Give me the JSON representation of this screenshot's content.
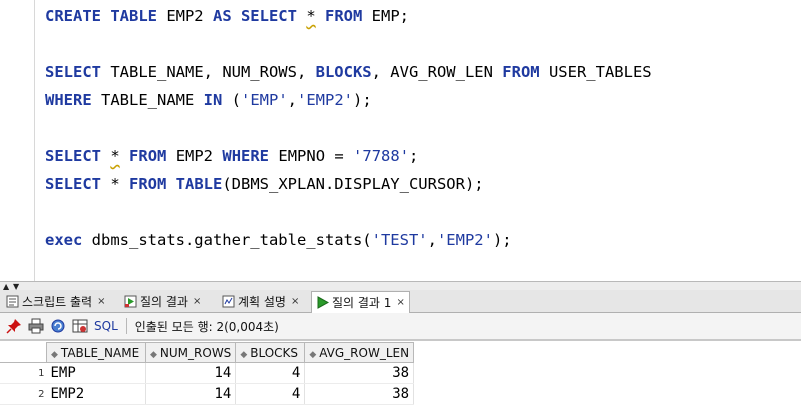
{
  "editor": {
    "lines": [
      {
        "tokens": [
          {
            "t": "CREATE TABLE",
            "k": "kw"
          },
          {
            "t": " EMP2 ",
            "k": "plain"
          },
          {
            "t": "AS SELECT",
            "k": "kw"
          },
          {
            "t": " ",
            "k": "plain"
          },
          {
            "t": "*",
            "k": "warn"
          },
          {
            "t": " ",
            "k": "plain"
          },
          {
            "t": "FROM",
            "k": "kw"
          },
          {
            "t": " EMP;",
            "k": "plain"
          }
        ]
      },
      {
        "tokens": []
      },
      {
        "tokens": [
          {
            "t": "SELECT",
            "k": "kw"
          },
          {
            "t": " TABLE_NAME, NUM_ROWS, ",
            "k": "plain"
          },
          {
            "t": "BLOCKS",
            "k": "kw"
          },
          {
            "t": ", AVG_ROW_LEN ",
            "k": "plain"
          },
          {
            "t": "FROM",
            "k": "kw"
          },
          {
            "t": " USER_TABLES",
            "k": "plain"
          }
        ]
      },
      {
        "tokens": [
          {
            "t": "WHERE",
            "k": "kw"
          },
          {
            "t": " TABLE_NAME ",
            "k": "plain"
          },
          {
            "t": "IN",
            "k": "kw"
          },
          {
            "t": " (",
            "k": "plain"
          },
          {
            "t": "'EMP'",
            "k": "str"
          },
          {
            "t": ",",
            "k": "plain"
          },
          {
            "t": "'EMP2'",
            "k": "str"
          },
          {
            "t": ");",
            "k": "plain"
          }
        ]
      },
      {
        "tokens": []
      },
      {
        "tokens": [
          {
            "t": "SELECT",
            "k": "kw"
          },
          {
            "t": " ",
            "k": "plain"
          },
          {
            "t": "*",
            "k": "warn"
          },
          {
            "t": " ",
            "k": "plain"
          },
          {
            "t": "FROM",
            "k": "kw"
          },
          {
            "t": " EMP2 ",
            "k": "plain"
          },
          {
            "t": "WHERE",
            "k": "kw"
          },
          {
            "t": " EMPNO = ",
            "k": "plain"
          },
          {
            "t": "'7788'",
            "k": "str"
          },
          {
            "t": ";",
            "k": "plain"
          }
        ]
      },
      {
        "tokens": [
          {
            "t": "SELECT",
            "k": "kw"
          },
          {
            "t": " * ",
            "k": "plain"
          },
          {
            "t": "FROM TABLE",
            "k": "kw"
          },
          {
            "t": "(DBMS_XPLAN.DISPLAY_CURSOR);",
            "k": "plain"
          }
        ]
      },
      {
        "tokens": []
      },
      {
        "tokens": [
          {
            "t": "exec",
            "k": "kw"
          },
          {
            "t": " dbms_stats.gather_table_stats(",
            "k": "plain"
          },
          {
            "t": "'TEST'",
            "k": "str"
          },
          {
            "t": ",",
            "k": "plain"
          },
          {
            "t": "'EMP2'",
            "k": "str"
          },
          {
            "t": ");",
            "k": "plain"
          }
        ]
      }
    ]
  },
  "tabs": [
    {
      "label": "스크립트 출력",
      "icon": "script-output-icon",
      "active": false
    },
    {
      "label": "질의 결과",
      "icon": "query-result-icon",
      "active": false
    },
    {
      "label": "계획 설명",
      "icon": "explain-plan-icon",
      "active": false
    },
    {
      "label": "질의 결과 1",
      "icon": "run-icon",
      "active": true
    }
  ],
  "tab_close_label": "×",
  "toolbar": {
    "sql_label": "SQL",
    "status": "인출된 모든 행: 2(0,004초)"
  },
  "grid": {
    "columns": [
      "TABLE_NAME",
      "NUM_ROWS",
      "BLOCKS",
      "AVG_ROW_LEN"
    ],
    "rows": [
      {
        "n": "1",
        "cells": [
          "EMP",
          "14",
          "4",
          "38"
        ]
      },
      {
        "n": "2",
        "cells": [
          "EMP2",
          "14",
          "4",
          "38"
        ]
      }
    ]
  },
  "colors": {
    "keyword": "#1f3aa0",
    "string": "#1f3aa0",
    "pin": "#cc1111",
    "run": "#2a9a2a"
  }
}
